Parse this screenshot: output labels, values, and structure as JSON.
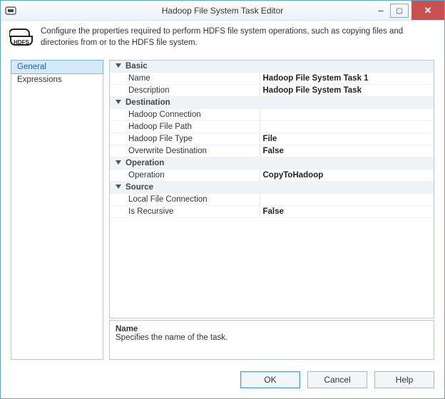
{
  "window": {
    "title": "Hadoop File System Task Editor"
  },
  "header": {
    "text": "Configure the properties required to perform HDFS file system operations, such as copying files and directories from or to the HDFS file system.",
    "icon_label": "HDFS"
  },
  "sidebar": {
    "items": [
      {
        "label": "General",
        "active": true
      },
      {
        "label": "Expressions",
        "active": false
      }
    ]
  },
  "property_grid": {
    "categories": [
      {
        "name": "Basic",
        "rows": [
          {
            "label": "Name",
            "value": "Hadoop File System Task 1"
          },
          {
            "label": "Description",
            "value": "Hadoop File System Task"
          }
        ]
      },
      {
        "name": "Destination",
        "rows": [
          {
            "label": "Hadoop Connection",
            "value": ""
          },
          {
            "label": "Hadoop File Path",
            "value": ""
          },
          {
            "label": "Hadoop File Type",
            "value": "File"
          },
          {
            "label": "Overwrite Destination",
            "value": "False"
          }
        ]
      },
      {
        "name": "Operation",
        "rows": [
          {
            "label": "Operation",
            "value": "CopyToHadoop"
          }
        ]
      },
      {
        "name": "Source",
        "rows": [
          {
            "label": "Local File Connection",
            "value": ""
          },
          {
            "label": "Is Recursive",
            "value": "False"
          }
        ]
      }
    ]
  },
  "help_pane": {
    "title": "Name",
    "description": "Specifies the name of the task."
  },
  "footer": {
    "ok": "OK",
    "cancel": "Cancel",
    "help": "Help"
  }
}
